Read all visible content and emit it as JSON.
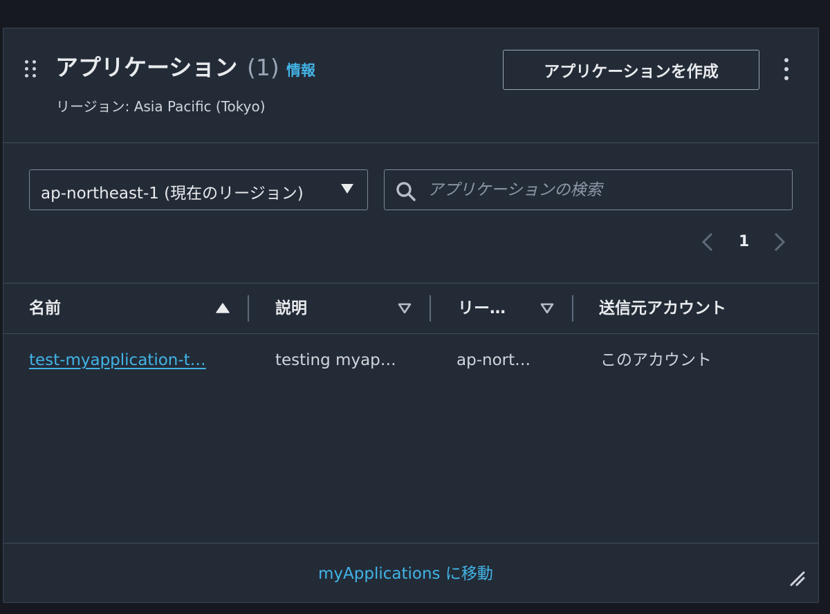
{
  "widget": {
    "title": "アプリケーション",
    "count": "(1)",
    "info_label": "情報",
    "subtitle": "リージョン: Asia Pacific (Tokyo)",
    "create_button_label": "アプリケーションを作成"
  },
  "filters": {
    "region_value": "ap-northeast-1 (現在のリージョン)",
    "search_placeholder": "アプリケーションの検索",
    "search_value": ""
  },
  "pagination": {
    "current_page": "1"
  },
  "table": {
    "columns": [
      {
        "label": "名前",
        "sort": "ascending"
      },
      {
        "label": "説明",
        "sort": "sortable"
      },
      {
        "label": "リー…",
        "sort": "sortable"
      },
      {
        "label": "送信元アカウント",
        "sort": "none"
      }
    ],
    "rows": [
      {
        "name": "test-myapplication-t…",
        "description": "testing myap…",
        "region": "ap-nort…",
        "source_account": "このアカウント"
      }
    ]
  },
  "footer": {
    "link_label": "myApplications に移動"
  },
  "colors": {
    "link": "#42b4e6",
    "background": "#232b37"
  },
  "icons": [
    "drag-handle-icon",
    "kebab-menu-icon",
    "chevron-down-icon",
    "search-icon",
    "chevron-left-icon",
    "chevron-right-icon",
    "sort-ascending-icon",
    "sort-icon",
    "resize-handle-icon"
  ]
}
